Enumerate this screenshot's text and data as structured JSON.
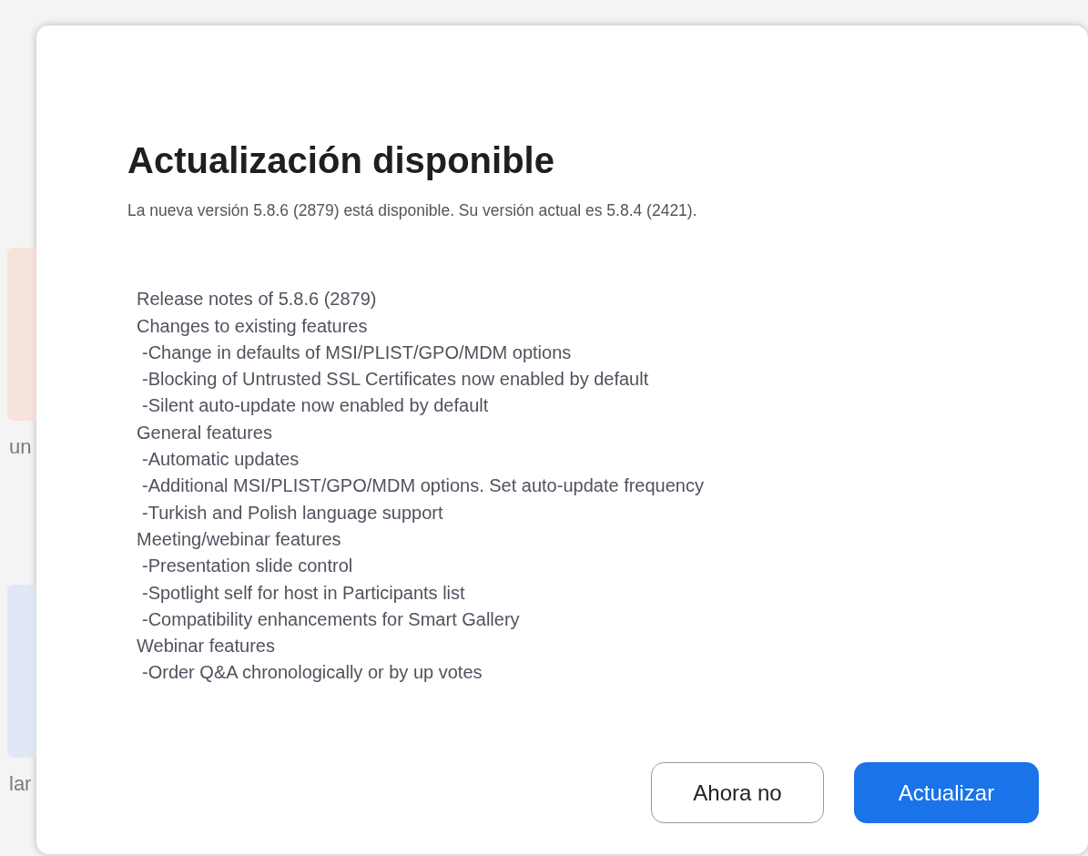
{
  "background_app": {
    "tiles": [
      {
        "color": "#f7ddd2",
        "label": "un"
      },
      {
        "color": "#d7e3f5",
        "label": "lar"
      }
    ]
  },
  "dialog": {
    "title": "Actualización disponible",
    "subtitle": "La nueva versión 5.8.6 (2879) está disponible. Su versión actual es 5.8.4 (2421).",
    "release_notes": [
      {
        "kind": "heading",
        "text": "Release notes of 5.8.6 (2879)"
      },
      {
        "kind": "heading",
        "text": "Changes to existing features"
      },
      {
        "kind": "item",
        "text": "-Change in defaults of MSI/PLIST/GPO/MDM options"
      },
      {
        "kind": "item",
        "text": "-Blocking of Untrusted SSL Certificates now enabled by default"
      },
      {
        "kind": "item",
        "text": "-Silent auto-update now enabled by default"
      },
      {
        "kind": "heading",
        "text": "General features"
      },
      {
        "kind": "item",
        "text": "-Automatic updates"
      },
      {
        "kind": "item",
        "text": "-Additional MSI/PLIST/GPO/MDM options. Set auto-update frequency"
      },
      {
        "kind": "item",
        "text": "-Turkish and Polish language support"
      },
      {
        "kind": "heading",
        "text": "Meeting/webinar features"
      },
      {
        "kind": "item",
        "text": "-Presentation slide control"
      },
      {
        "kind": "item",
        "text": "-Spotlight self for host in Participants list"
      },
      {
        "kind": "item",
        "text": "-Compatibility enhancements for Smart Gallery"
      },
      {
        "kind": "heading",
        "text": "Webinar features"
      },
      {
        "kind": "item",
        "text": "-Order Q&A chronologically or by up votes"
      }
    ],
    "buttons": [
      {
        "kind": "secondary",
        "label": "Ahora no"
      },
      {
        "kind": "primary",
        "label": "Actualizar"
      }
    ]
  }
}
